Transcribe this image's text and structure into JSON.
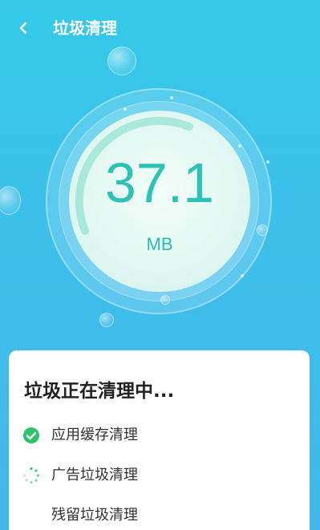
{
  "header": {
    "title": "垃圾清理",
    "back_icon": "chevron-left-icon"
  },
  "gauge": {
    "value": "37.1",
    "unit": "MB"
  },
  "card": {
    "title": "垃圾正在清理中...",
    "tasks": [
      {
        "label": "应用缓存清理",
        "status": "done",
        "icon": "check-circle-icon"
      },
      {
        "label": "广告垃圾清理",
        "status": "in-progress",
        "icon": "spinner-icon"
      },
      {
        "label": "残留垃圾清理",
        "status": "pending",
        "icon": ""
      }
    ]
  },
  "colors": {
    "accent": "#2cc3b4",
    "background": "#3dc0ea",
    "check": "#2dc36a"
  }
}
